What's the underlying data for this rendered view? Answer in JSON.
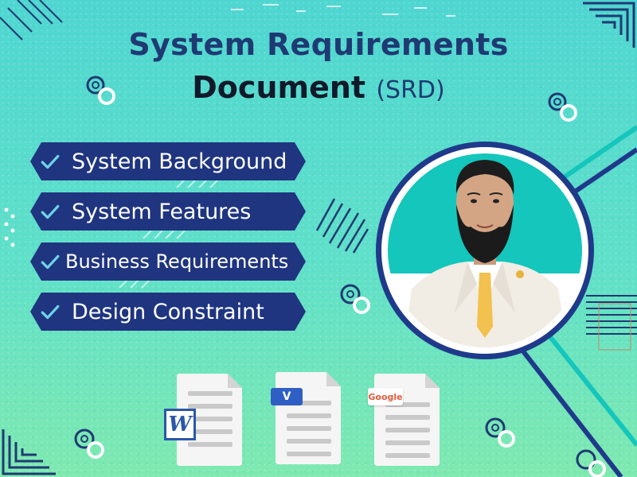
{
  "header": {
    "title_line1": "System Requirements",
    "title_line2": "Document",
    "title_abbr": "(SRD)"
  },
  "features": [
    {
      "label": "System Background"
    },
    {
      "label": "System Features"
    },
    {
      "label": "Business Requirements"
    },
    {
      "label": "Design Constraint"
    }
  ],
  "icons": {
    "check": "check-icon",
    "word_letter": "W",
    "visio_letter": "V",
    "google_label": "Google"
  },
  "colors": {
    "navy": "#1f3580",
    "teal": "#14c6bb",
    "background_top": "#4fd6d1",
    "background_bottom": "#7fe9b0"
  }
}
